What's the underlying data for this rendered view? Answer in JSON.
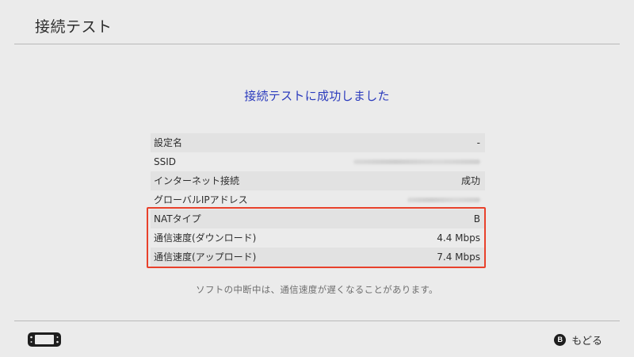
{
  "header": {
    "title": "接続テスト"
  },
  "result": {
    "message": "接続テストに成功しました"
  },
  "info_rows": [
    {
      "label": "設定名",
      "value": "-"
    },
    {
      "label": "SSID",
      "value": ""
    },
    {
      "label": "インターネット接続",
      "value": "成功"
    },
    {
      "label": "グローバルIPアドレス",
      "value": ""
    },
    {
      "label": "NATタイプ",
      "value": "B"
    },
    {
      "label": "通信速度(ダウンロード)",
      "value": "4.4 Mbps"
    },
    {
      "label": "通信速度(アップロード)",
      "value": "7.4 Mbps"
    }
  ],
  "note": "ソフトの中断中は、通信速度が遅くなることがあります。",
  "footer": {
    "console_icon": "handheld-console-icon",
    "back_button_icon": "B",
    "back_label": "もどる"
  },
  "colors": {
    "background": "#ebebeb",
    "accent_text": "#2b3bbd",
    "highlight_border": "#e8412b"
  }
}
